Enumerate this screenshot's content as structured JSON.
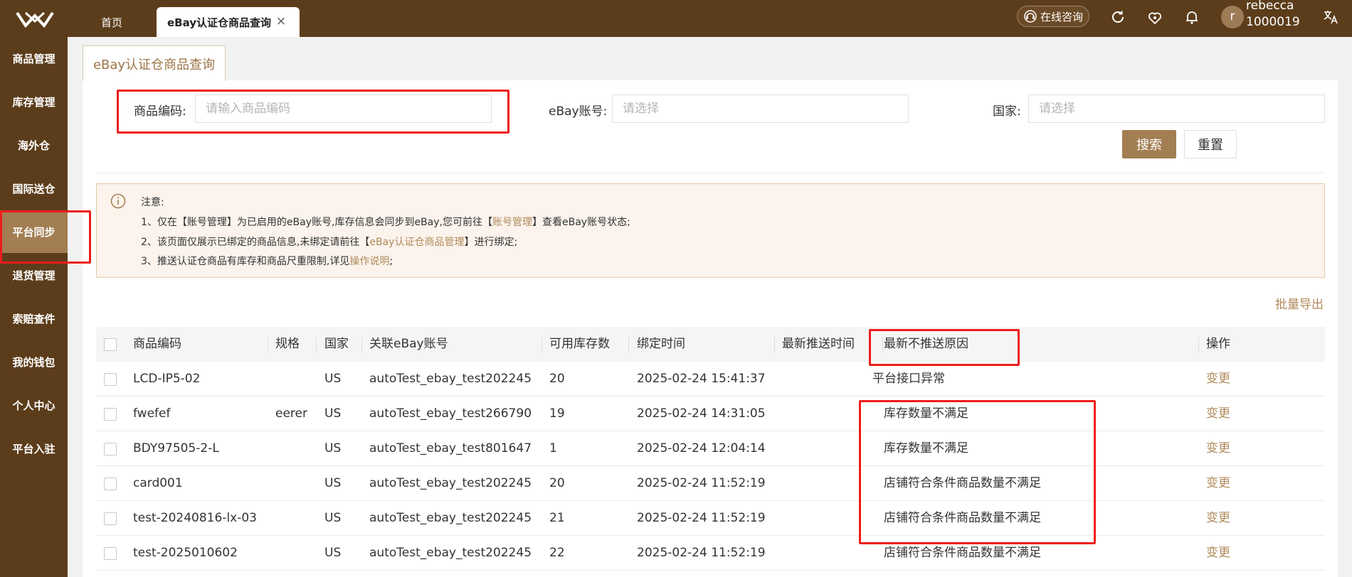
{
  "header": {
    "tabs": [
      {
        "label": "首页"
      },
      {
        "label": "eBay认证仓商品查询"
      }
    ],
    "consult_label": "在线咨询",
    "user": {
      "avatar_letter": "r",
      "name": "rebecca",
      "id": "1000019"
    }
  },
  "sidebar": {
    "items": [
      {
        "label": "商品管理"
      },
      {
        "label": "库存管理"
      },
      {
        "label": "海外仓"
      },
      {
        "label": "国际送仓"
      },
      {
        "label": "平台同步"
      },
      {
        "label": "退货管理"
      },
      {
        "label": "索赔查件"
      },
      {
        "label": "我的钱包"
      },
      {
        "label": "个人中心"
      },
      {
        "label": "平台入驻"
      }
    ],
    "active_index": 4
  },
  "page": {
    "tab_label": "eBay认证仓商品查询"
  },
  "filters": {
    "product_code": {
      "label": "商品编码:",
      "placeholder": "请输入商品编码"
    },
    "ebay_account": {
      "label": "eBay账号:",
      "placeholder": "请选择"
    },
    "country": {
      "label": "国家:",
      "placeholder": "请选择"
    },
    "search_label": "搜索",
    "reset_label": "重置"
  },
  "notice": {
    "title": "注意:",
    "line1": {
      "prefix": "1、仅在【账号管理】为已启用的eBay账号,库存信息会同步到eBay,您可前往【",
      "link": "账号管理",
      "suffix": "】查看eBay账号状态;"
    },
    "line2": {
      "prefix": "2、该页面仅展示已绑定的商品信息,未绑定请前往【",
      "link": "eBay认证仓商品管理",
      "suffix": "】进行绑定;"
    },
    "line3": {
      "prefix": "3、推送认证仓商品有库存和商品尺重限制,详见",
      "link": "操作说明",
      "suffix": ";"
    }
  },
  "export_label": "批量导出",
  "table": {
    "headers": {
      "code": "商品编码",
      "spec": "规格",
      "country": "国家",
      "account": "关联eBay账号",
      "stock": "可用库存数",
      "bind_time": "绑定时间",
      "push_time": "最新推送时间",
      "reason": "最新不推送原因",
      "op": "操作"
    },
    "rows": [
      {
        "code": "LCD-IP5-02",
        "spec": "",
        "country": "US",
        "account": "autoTest_ebay_test202245",
        "stock": "20",
        "bind_time": "2025-02-24 15:41:37",
        "push_time": "",
        "reason": "平台接口异常",
        "op": "变更"
      },
      {
        "code": "fwefef",
        "spec": "eerer",
        "country": "US",
        "account": "autoTest_ebay_test266790",
        "stock": "19",
        "bind_time": "2025-02-24 14:31:05",
        "push_time": "",
        "reason": "库存数量不满足",
        "op": "变更"
      },
      {
        "code": "BDY97505-2-L",
        "spec": "",
        "country": "US",
        "account": "autoTest_ebay_test801647",
        "stock": "1",
        "bind_time": "2025-02-24 12:04:14",
        "push_time": "",
        "reason": "库存数量不满足",
        "op": "变更"
      },
      {
        "code": "card001",
        "spec": "",
        "country": "US",
        "account": "autoTest_ebay_test202245",
        "stock": "20",
        "bind_time": "2025-02-24 11:52:19",
        "push_time": "",
        "reason": "店铺符合条件商品数量不满足",
        "op": "变更"
      },
      {
        "code": "test-20240816-lx-03",
        "spec": "",
        "country": "US",
        "account": "autoTest_ebay_test202245",
        "stock": "21",
        "bind_time": "2025-02-24 11:52:19",
        "push_time": "",
        "reason": "店铺符合条件商品数量不满足",
        "op": "变更"
      },
      {
        "code": "test-2025010602",
        "spec": "",
        "country": "US",
        "account": "autoTest_ebay_test202245",
        "stock": "22",
        "bind_time": "2025-02-24 11:52:19",
        "push_time": "",
        "reason": "店铺符合条件商品数量不满足",
        "op": "变更"
      }
    ]
  },
  "colors": {
    "brand": "#5c3d1b",
    "accent": "#a27e52",
    "link": "#b08a5a",
    "highlight": "#ee1c1c"
  }
}
